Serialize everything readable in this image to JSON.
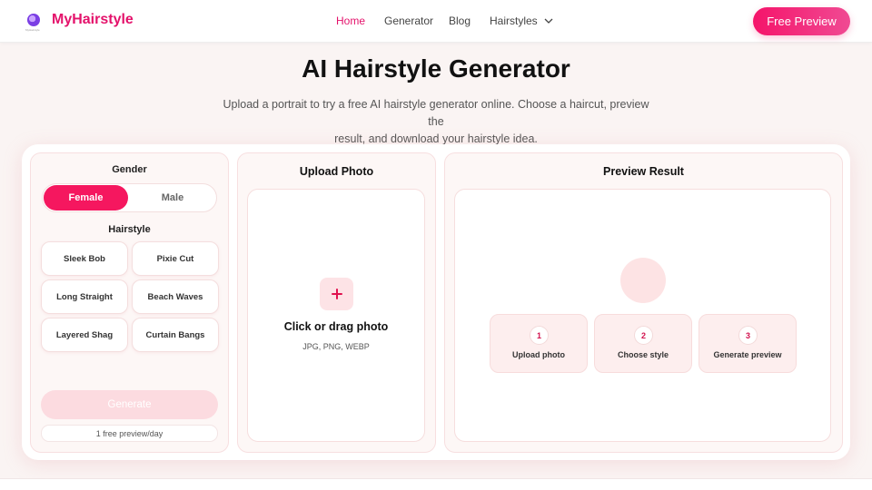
{
  "header": {
    "brand": "MyHairstyle",
    "logo_sub": "MyHairstyle",
    "nav": {
      "home": "Home",
      "generator": "Generator",
      "blog": "Blog",
      "hairstyles": "Hairstyles"
    },
    "cta": "Free Preview"
  },
  "hero": {
    "title": "AI Hairstyle Generator",
    "subtitle_line1": "Upload a portrait to try a free AI hairstyle generator online. Choose a haircut, preview the",
    "subtitle_line2": "result, and download your hairstyle idea."
  },
  "left_panel": {
    "gender_label": "Gender",
    "gender_options": [
      "Female",
      "Male"
    ],
    "selected_gender": "Female",
    "hairstyle_label": "Hairstyle",
    "styles": [
      "Sleek Bob",
      "Pixie Cut",
      "Long Straight",
      "Beach Waves",
      "Layered Shag",
      "Curtain Bangs"
    ],
    "generate_label": "Generate",
    "quota": "1 free preview/day"
  },
  "upload_panel": {
    "title": "Upload Photo",
    "drop_title": "Click or drag photo",
    "formats": "JPG, PNG, WEBP"
  },
  "preview_panel": {
    "title": "Preview Result",
    "steps": [
      {
        "num": "1",
        "label": "Upload photo"
      },
      {
        "num": "2",
        "label": "Choose style"
      },
      {
        "num": "3",
        "label": "Generate preview"
      }
    ]
  },
  "colors": {
    "accent": "#e4126b",
    "primary_button": "#f5175f",
    "background": "#faf4f3"
  },
  "icons": {
    "logo": "hair-profile-icon",
    "nav_dropdown": "chevron-down-icon",
    "upload": "plus-icon"
  }
}
